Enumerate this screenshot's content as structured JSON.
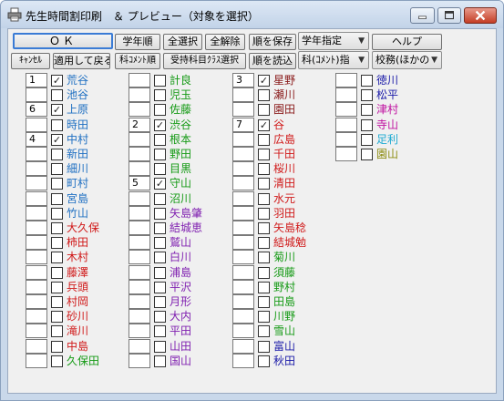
{
  "window": {
    "title": "先生時間割印刷　＆ プレビュー（対象を選択）",
    "icons": {
      "app": "printer-icon",
      "minimize": "minimize-icon",
      "maximize": "maximize-icon",
      "close": "close-icon"
    }
  },
  "toolbar": {
    "ok": "ＯＫ",
    "grade_order": "学年順",
    "select_all": "全選択",
    "deselect_all": "全解除",
    "save_order": "順を保存",
    "grade_select": "学年指定",
    "help": "ヘルプ",
    "cancel": "ｷｬﾝｾﾙ",
    "apply_return": "適用して戻る",
    "subject_order": "科ｺﾒﾝﾄ順",
    "class_select": "受持科目ｸﾗｽ選択",
    "load_order": "順を読込",
    "subject_combo": "科(ｺﾒﾝﾄ)指",
    "duty_combo": "校務(ほかの"
  },
  "colors": {
    "blue": "#1e6fc2",
    "red": "#d01818",
    "green": "#159a15",
    "purple": "#7f1fb0",
    "navy": "#1a1aa8",
    "maroon": "#8a1a1a",
    "cyan": "#1eaad2",
    "olive": "#8c8c10",
    "darkgreen": "#1f7f1f",
    "magenta": "#c010a0"
  },
  "columns": [
    {
      "rows": [
        {
          "num": "1",
          "checked": true,
          "name": "荒谷",
          "color": "blue"
        },
        {
          "num": "",
          "checked": false,
          "name": "池谷",
          "color": "blue"
        },
        {
          "num": "6",
          "checked": true,
          "name": "上原",
          "color": "blue"
        },
        {
          "num": "",
          "checked": false,
          "name": "時田",
          "color": "blue"
        },
        {
          "num": "4",
          "checked": true,
          "name": "中村",
          "color": "blue"
        },
        {
          "num": "",
          "checked": false,
          "name": "新田",
          "color": "blue"
        },
        {
          "num": "",
          "checked": false,
          "name": "細川",
          "color": "blue"
        },
        {
          "num": "",
          "checked": false,
          "name": "町村",
          "color": "blue"
        },
        {
          "num": "",
          "checked": false,
          "name": "宮島",
          "color": "blue"
        },
        {
          "num": "",
          "checked": false,
          "name": "竹山",
          "color": "blue"
        },
        {
          "num": "",
          "checked": false,
          "name": "大久保",
          "color": "red"
        },
        {
          "num": "",
          "checked": false,
          "name": "柿田",
          "color": "red"
        },
        {
          "num": "",
          "checked": false,
          "name": "木村",
          "color": "red"
        },
        {
          "num": "",
          "checked": false,
          "name": "藤澤",
          "color": "red"
        },
        {
          "num": "",
          "checked": false,
          "name": "兵頭",
          "color": "red"
        },
        {
          "num": "",
          "checked": false,
          "name": "村岡",
          "color": "red"
        },
        {
          "num": "",
          "checked": false,
          "name": "砂川",
          "color": "red"
        },
        {
          "num": "",
          "checked": false,
          "name": "滝川",
          "color": "red"
        },
        {
          "num": "",
          "checked": false,
          "name": "中島",
          "color": "red"
        },
        {
          "num": "",
          "checked": false,
          "name": "久保田",
          "color": "green"
        }
      ]
    },
    {
      "rows": [
        {
          "num": "",
          "checked": false,
          "name": "計良",
          "color": "green"
        },
        {
          "num": "",
          "checked": false,
          "name": "児玉",
          "color": "green"
        },
        {
          "num": "",
          "checked": false,
          "name": "佐藤",
          "color": "green"
        },
        {
          "num": "2",
          "checked": true,
          "name": "渋谷",
          "color": "green"
        },
        {
          "num": "",
          "checked": false,
          "name": "根本",
          "color": "green"
        },
        {
          "num": "",
          "checked": false,
          "name": "野田",
          "color": "green"
        },
        {
          "num": "",
          "checked": false,
          "name": "目黒",
          "color": "green"
        },
        {
          "num": "5",
          "checked": true,
          "name": "守山",
          "color": "green"
        },
        {
          "num": "",
          "checked": false,
          "name": "沼川",
          "color": "green"
        },
        {
          "num": "",
          "checked": false,
          "name": "矢島肇",
          "color": "purple"
        },
        {
          "num": "",
          "checked": false,
          "name": "結城恵",
          "color": "purple"
        },
        {
          "num": "",
          "checked": false,
          "name": "鷲山",
          "color": "purple"
        },
        {
          "num": "",
          "checked": false,
          "name": "白川",
          "color": "purple"
        },
        {
          "num": "",
          "checked": false,
          "name": "浦島",
          "color": "purple"
        },
        {
          "num": "",
          "checked": false,
          "name": "平沢",
          "color": "purple"
        },
        {
          "num": "",
          "checked": false,
          "name": "月形",
          "color": "purple"
        },
        {
          "num": "",
          "checked": false,
          "name": "大内",
          "color": "purple"
        },
        {
          "num": "",
          "checked": false,
          "name": "平田",
          "color": "purple"
        },
        {
          "num": "",
          "checked": false,
          "name": "山田",
          "color": "purple"
        },
        {
          "num": "",
          "checked": false,
          "name": "国山",
          "color": "purple"
        }
      ]
    },
    {
      "rows": [
        {
          "num": "3",
          "checked": true,
          "name": "星野",
          "color": "maroon"
        },
        {
          "num": "",
          "checked": false,
          "name": "瀬川",
          "color": "maroon"
        },
        {
          "num": "",
          "checked": false,
          "name": "園田",
          "color": "maroon"
        },
        {
          "num": "7",
          "checked": true,
          "name": "谷",
          "color": "red"
        },
        {
          "num": "",
          "checked": false,
          "name": "広島",
          "color": "red"
        },
        {
          "num": "",
          "checked": false,
          "name": "千田",
          "color": "red"
        },
        {
          "num": "",
          "checked": false,
          "name": "桜川",
          "color": "red"
        },
        {
          "num": "",
          "checked": false,
          "name": "清田",
          "color": "red"
        },
        {
          "num": "",
          "checked": false,
          "name": "水元",
          "color": "red"
        },
        {
          "num": "",
          "checked": false,
          "name": "羽田",
          "color": "red"
        },
        {
          "num": "",
          "checked": false,
          "name": "矢島稔",
          "color": "red"
        },
        {
          "num": "",
          "checked": false,
          "name": "結城勉",
          "color": "red"
        },
        {
          "num": "",
          "checked": false,
          "name": "菊川",
          "color": "green"
        },
        {
          "num": "",
          "checked": false,
          "name": "須藤",
          "color": "green"
        },
        {
          "num": "",
          "checked": false,
          "name": "野村",
          "color": "green"
        },
        {
          "num": "",
          "checked": false,
          "name": "田島",
          "color": "green"
        },
        {
          "num": "",
          "checked": false,
          "name": "川野",
          "color": "green"
        },
        {
          "num": "",
          "checked": false,
          "name": "雪山",
          "color": "green"
        },
        {
          "num": "",
          "checked": false,
          "name": "富山",
          "color": "navy"
        },
        {
          "num": "",
          "checked": false,
          "name": "秋田",
          "color": "navy"
        }
      ]
    },
    {
      "rows": [
        {
          "num": "",
          "checked": false,
          "name": "徳川",
          "color": "navy"
        },
        {
          "num": "",
          "checked": false,
          "name": "松平",
          "color": "navy"
        },
        {
          "num": "",
          "checked": false,
          "name": "津村",
          "color": "magenta"
        },
        {
          "num": "",
          "checked": false,
          "name": "寺山",
          "color": "magenta"
        },
        {
          "num": "",
          "checked": false,
          "name": "足利",
          "color": "cyan"
        },
        {
          "num": "",
          "checked": false,
          "name": "園山",
          "color": "olive"
        }
      ]
    }
  ]
}
